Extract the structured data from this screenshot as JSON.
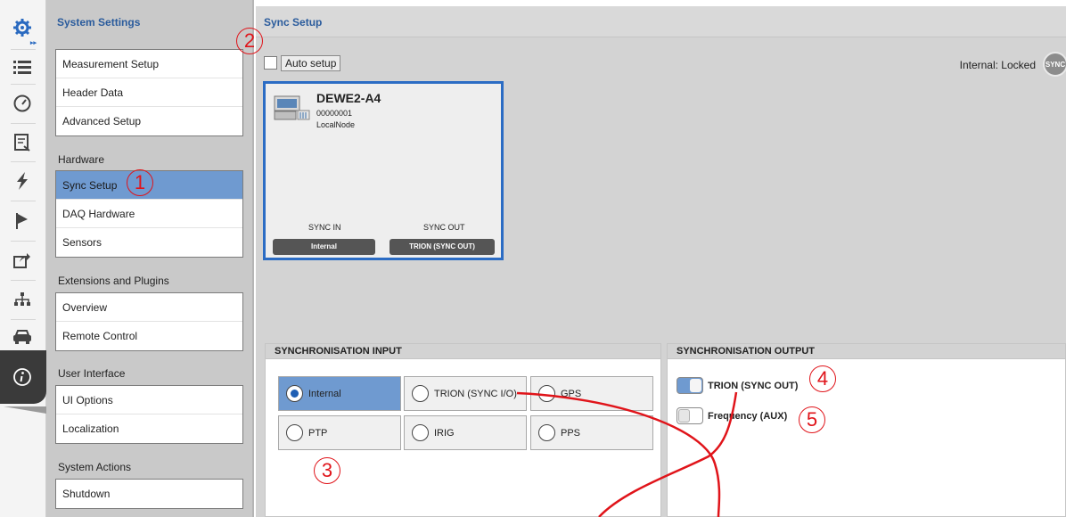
{
  "rail": {
    "icons": [
      "gear-icon",
      "list-icon",
      "gauge-icon",
      "report-icon",
      "lightning-icon",
      "flag-icon",
      "export-icon",
      "network-icon",
      "car-icon",
      "info-icon"
    ]
  },
  "settings": {
    "title": "System Settings",
    "group1": [
      "Measurement Setup",
      "Header Data",
      "Advanced Setup"
    ],
    "hardware_label": "Hardware",
    "hardware": [
      "Sync Setup",
      "DAQ Hardware",
      "Sensors"
    ],
    "extensions_label": "Extensions and Plugins",
    "extensions": [
      "Overview",
      "Remote Control"
    ],
    "ui_label": "User Interface",
    "ui": [
      "UI Options",
      "Localization"
    ],
    "actions_label": "System Actions",
    "actions": [
      "Shutdown"
    ]
  },
  "header": {
    "title": "Sync Setup"
  },
  "toolbar": {
    "auto_setup": "Auto setup",
    "lock_status": "Internal: Locked",
    "lock_icon_text": "SYNC"
  },
  "device": {
    "name": "DEWE2-A4",
    "serial": "00000001",
    "node": "LocalNode",
    "sync_in_label": "SYNC IN",
    "sync_out_label": "SYNC OUT",
    "sync_in_value": "Internal",
    "sync_out_value": "TRION (SYNC OUT)"
  },
  "sync_input": {
    "title": "SYNCHRONISATION INPUT",
    "options": [
      "Internal",
      "TRION (SYNC I/O)",
      "GPS",
      "PTP",
      "IRIG",
      "PPS"
    ],
    "selected": "Internal"
  },
  "sync_output": {
    "title": "SYNCHRONISATION OUTPUT",
    "trion_label": "TRION (SYNC OUT)",
    "trion_on": true,
    "freq_label": "Frequency (AUX)",
    "freq_on": false
  },
  "annotations": [
    "1",
    "2",
    "3",
    "4",
    "5"
  ],
  "colors": {
    "accent": "#2a5b9c",
    "selected": "#6f9ad0",
    "annotation": "#e0141a"
  }
}
